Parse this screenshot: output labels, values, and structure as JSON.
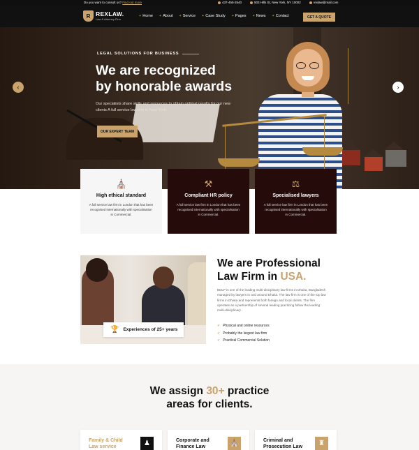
{
  "topbar": {
    "question": "Do you want to consult us?",
    "question_link": "Find out more",
    "phone": "437-455-2540",
    "address": "503 Hills St, New York, NY 10002",
    "email": "rexlaw@mail.com"
  },
  "nav": {
    "logo_name": "REXLAW.",
    "logo_tagline": "Law & Attorney Firm",
    "items": [
      "Home",
      "About",
      "Service",
      "Case Study",
      "Pages",
      "News",
      "Contact"
    ],
    "cta": "GET A QUOTE"
  },
  "hero": {
    "eyebrow": "LEGAL SOLUTIONS FOR BUSINESS",
    "title_line1": "We are recognized",
    "title_line2": "by honorable awards",
    "text": "Our specialists share skills and resources to obtain optimal results for our new clients A full service law firm in New York.",
    "button": "OUR EXPERT TEAM",
    "prev": "‹",
    "next": "›"
  },
  "features": [
    {
      "title": "High ethical standard",
      "text": "A full service law firm in London that has been recognised internationally with specialisation in Commercial."
    },
    {
      "title": "Compliant HR policy",
      "text": "A full service law firm in London that has been recognised internationally with specialisation in Commercial."
    },
    {
      "title": "Specialised lawyers",
      "text": "A full service law firm in London that has been recognised internationally with specialisation in Commercial."
    }
  ],
  "about": {
    "badge": "Experiences of 25+ years",
    "title_line1": "We are Professional",
    "title_line2_a": "Law Firm in ",
    "title_line2_b": "USA.",
    "text": "BDLP is one of the leading multi-disciplinary law firms in Dhaka, Bangladesh managed by lawyers in and around Dhaka. The law firm is one of the top law firms in Dhaka and represents both foreign and local clients. The firm operates as a partnership of several leading practicing follow the leading multi-disciplinary .",
    "checks": [
      "Physical and online resources",
      "Probably the largest law firm",
      "Practical Commercial Solution"
    ]
  },
  "practice": {
    "title_a": "We assign ",
    "title_hl": "30+",
    "title_b": " practice",
    "title_line2": "areas for clients.",
    "cards": [
      {
        "line1": "Family & Child",
        "line2": "Law service"
      },
      {
        "line1": "Corporate and",
        "line2": "Finance Law"
      },
      {
        "line1": "Criminal and",
        "line2": "Prosecution Law"
      }
    ]
  },
  "colors": {
    "accent": "#c9a36b",
    "dark": "#111111",
    "maroon": "#250c0b"
  }
}
